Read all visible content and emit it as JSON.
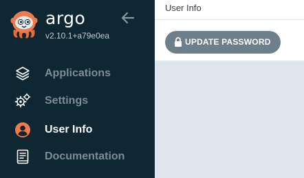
{
  "app": {
    "name": "argo",
    "version": "v2.10.1+a79e0ea",
    "logo_icon": "argo-octopus-logo",
    "collapse_icon": "arrow-left-icon"
  },
  "nav": {
    "items": [
      {
        "label": "Applications",
        "icon": "layers-icon",
        "active": false
      },
      {
        "label": "Settings",
        "icon": "gears-icon",
        "active": false
      },
      {
        "label": "User Info",
        "icon": "user-circle-icon",
        "active": true
      },
      {
        "label": "Documentation",
        "icon": "book-icon",
        "active": false
      }
    ]
  },
  "header": {
    "title": "User Info"
  },
  "toolbar": {
    "update_password_label": "UPDATE PASSWORD",
    "update_password_icon": "lock-icon"
  },
  "colors": {
    "sidebar_bg": "#0f2733",
    "accent": "#ef7b4d",
    "button_bg": "#6d7f8b",
    "content_bg": "#dee6eb"
  }
}
